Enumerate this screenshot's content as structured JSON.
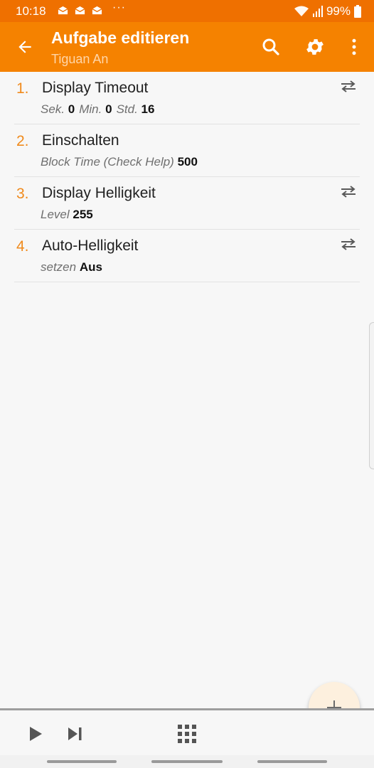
{
  "status_bar": {
    "time": "10:18",
    "more": "···",
    "battery": "99%"
  },
  "app_bar": {
    "title": "Aufgabe editieren",
    "subtitle": "Tiguan An"
  },
  "actions": [
    {
      "number": "1.",
      "name": "Display Timeout",
      "params": [
        {
          "label": "Sek.",
          "value": "0"
        },
        {
          "label": "Min.",
          "value": "0"
        },
        {
          "label": "Std.",
          "value": "16"
        }
      ],
      "has_swap": true
    },
    {
      "number": "2.",
      "name": "Einschalten",
      "params": [
        {
          "label": "Block Time (Check Help)",
          "value": "500"
        }
      ],
      "has_swap": false
    },
    {
      "number": "3.",
      "name": "Display Helligkeit",
      "params": [
        {
          "label": "Level",
          "value": "255"
        }
      ],
      "has_swap": true
    },
    {
      "number": "4.",
      "name": "Auto-Helligkeit",
      "params": [
        {
          "label": "setzen",
          "value": "Aus"
        }
      ],
      "has_swap": true
    }
  ],
  "fab": {
    "icon": "plus-icon",
    "label": "+"
  },
  "bottom_bar": {
    "icons": [
      "play-icon",
      "step-icon",
      "grid-icon"
    ]
  },
  "colors": {
    "status_bar": "#ef7000",
    "app_bar": "#f58200",
    "accent_number": "#f08a1c",
    "fab_bg": "#fdf0de"
  }
}
